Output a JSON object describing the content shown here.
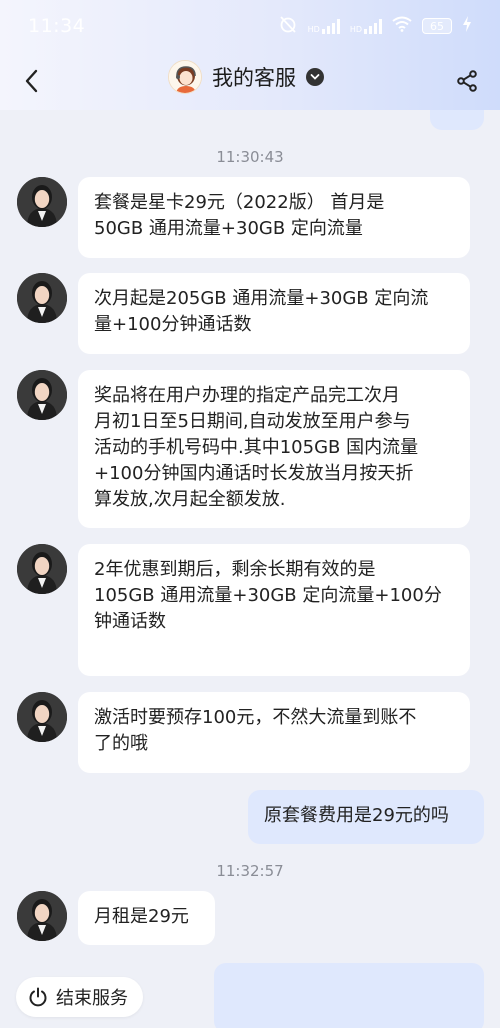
{
  "status_bar": {
    "time": "11:34",
    "network_1": "HD",
    "network_2": "HD",
    "battery": "65"
  },
  "header": {
    "title": "我的客服",
    "icons": [
      "back-arrow-icon",
      "agent-avatar-icon",
      "verified-chevron-icon",
      "share-icon"
    ]
  },
  "chat": {
    "timestamps": [
      "11:30:43",
      "11:32:57"
    ],
    "incoming": [
      {
        "lines": [
          "套餐是星卡29元（2022版） 首月是",
          "50GB 通用流量+30GB 定向流量"
        ]
      },
      {
        "lines": [
          "次月起是205GB 通用流量+30GB 定向流",
          "量+100分钟通话数"
        ]
      },
      {
        "lines": [
          "奖品将在用户办理的指定产品完工次月",
          "月初1日至5日期间,自动发放至用户参与",
          "活动的手机号码中.其中105GB 国内流量",
          "+100分钟国内通话时长发放当月按天折",
          "算发放,次月起全额发放."
        ]
      },
      {
        "lines": [
          "2年优惠到期后，剩余长期有效的是",
          "105GB 通用流量+30GB 定向流量+100分",
          "钟通话数"
        ]
      },
      {
        "lines": [
          "激活时要预存100元，不然大流量到账不",
          "了的哦"
        ]
      },
      {
        "lines": [
          "月租是29元"
        ]
      }
    ],
    "outgoing": [
      {
        "lines": [
          "原套餐费用是29元的吗"
        ]
      }
    ]
  },
  "footer": {
    "end_service_label": "结束服务"
  },
  "colors": {
    "background": "#eef0f7",
    "outgoing_bubble": "#dfe8fd",
    "incoming_bubble": "#ffffff",
    "timestamp": "#8a8d96"
  }
}
